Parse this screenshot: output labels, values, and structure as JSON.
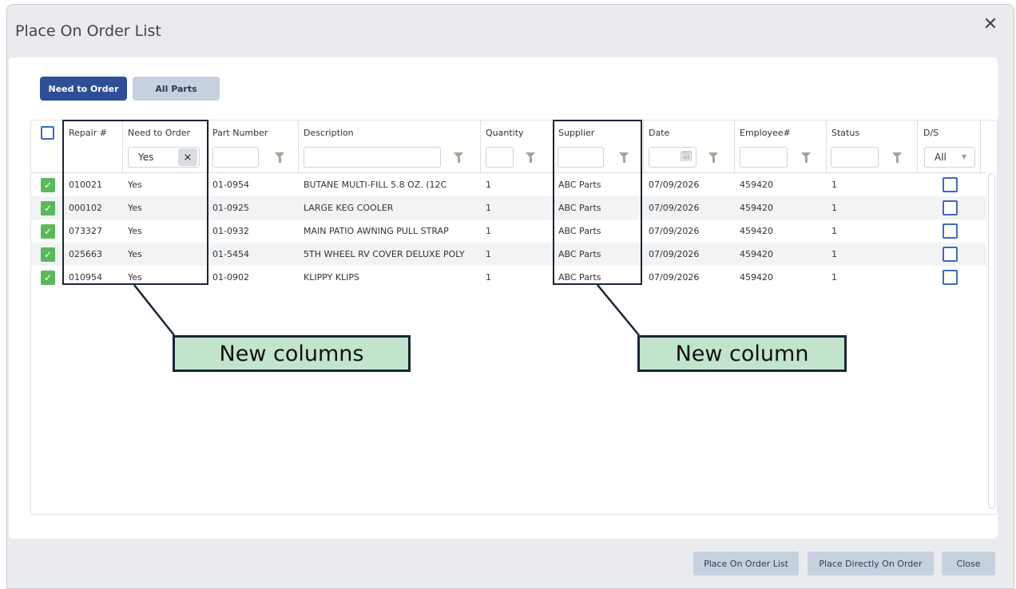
{
  "dialog": {
    "title": "Place On Order List",
    "close_glyph": "✕"
  },
  "tabs": [
    {
      "label": "Need to Order",
      "active": true
    },
    {
      "label": "All Parts",
      "active": false
    }
  ],
  "columns": {
    "repair": "Repair #",
    "need_to_order": "Need to Order",
    "part_number": "Part Number",
    "description": "Description",
    "quantity": "Quantity",
    "supplier": "Supplier",
    "date": "Date",
    "employee": "Employee#",
    "status": "Status",
    "ds": "D/S"
  },
  "filters": {
    "need_to_order_value": "Yes",
    "ds_value": "All"
  },
  "rows": [
    {
      "repair": "010021",
      "need": "Yes",
      "part": "01-0954",
      "desc": "BUTANE MULTI-FILL 5.8 OZ. (12C",
      "qty": "1",
      "supplier": "ABC Parts",
      "date": "07/09/2026",
      "employee": "459420",
      "status": "1"
    },
    {
      "repair": "000102",
      "need": "Yes",
      "part": "01-0925",
      "desc": "LARGE KEG COOLER",
      "qty": "1",
      "supplier": "ABC Parts",
      "date": "07/09/2026",
      "employee": "459420",
      "status": "1"
    },
    {
      "repair": "073327",
      "need": "Yes",
      "part": "01-0932",
      "desc": "MAIN PATIO AWNING PULL STRAP",
      "qty": "1",
      "supplier": "ABC Parts",
      "date": "07/09/2026",
      "employee": "459420",
      "status": "1"
    },
    {
      "repair": "025663",
      "need": "Yes",
      "part": "01-5454",
      "desc": "5TH WHEEL RV COVER DELUXE POLY",
      "qty": "1",
      "supplier": "ABC Parts",
      "date": "07/09/2026",
      "employee": "459420",
      "status": "1"
    },
    {
      "repair": "010954",
      "need": "Yes",
      "part": "01-0902",
      "desc": "KLIPPY KLIPS",
      "qty": "1",
      "supplier": "ABC Parts",
      "date": "07/09/2026",
      "employee": "459420",
      "status": "1"
    }
  ],
  "callouts": {
    "left": "New columns",
    "right": "New column"
  },
  "footer": {
    "place_on_order_list": "Place On Order List",
    "place_directly": "Place Directly On Order",
    "close": "Close"
  },
  "colors": {
    "accent": "#2e4f97",
    "check_green": "#5cb85c",
    "callout_fill": "#c3e4cc"
  }
}
